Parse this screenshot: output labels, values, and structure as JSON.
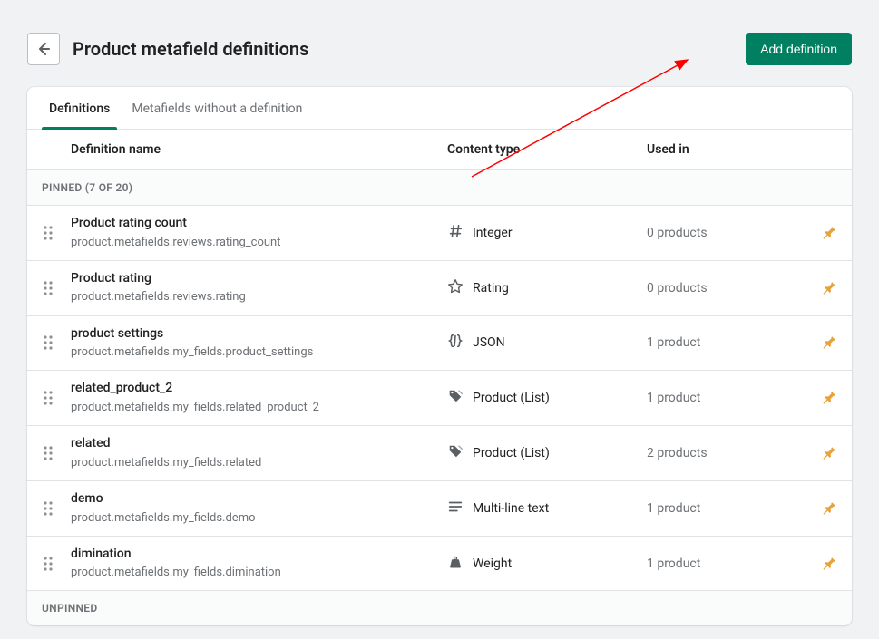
{
  "header": {
    "title": "Product metafield definitions",
    "add_button": "Add definition"
  },
  "tabs": {
    "definitions": "Definitions",
    "without": "Metafields without a definition"
  },
  "columns": {
    "name": "Definition name",
    "type": "Content type",
    "used": "Used in"
  },
  "sections": {
    "pinned": "PINNED (7 OF 20)",
    "unpinned": "UNPINNED"
  },
  "rows": [
    {
      "name": "Product rating count",
      "path": "product.metafields.reviews.rating_count",
      "type": "Integer",
      "icon": "hash",
      "used": "0 products"
    },
    {
      "name": "Product rating",
      "path": "product.metafields.reviews.rating",
      "type": "Rating",
      "icon": "star",
      "used": "0 products"
    },
    {
      "name": "product settings",
      "path": "product.metafields.my_fields.product_settings",
      "type": "JSON",
      "icon": "json",
      "used": "1 product"
    },
    {
      "name": "related_product_2",
      "path": "product.metafields.my_fields.related_product_2",
      "type": "Product (List)",
      "icon": "tag",
      "used": "1 product"
    },
    {
      "name": "related",
      "path": "product.metafields.my_fields.related",
      "type": "Product (List)",
      "icon": "tag",
      "used": "2 products"
    },
    {
      "name": "demo",
      "path": "product.metafields.my_fields.demo",
      "type": "Multi-line text",
      "icon": "lines",
      "used": "1 product"
    },
    {
      "name": "dimination",
      "path": "product.metafields.my_fields.dimination",
      "type": "Weight",
      "icon": "weight",
      "used": "1 product"
    }
  ]
}
